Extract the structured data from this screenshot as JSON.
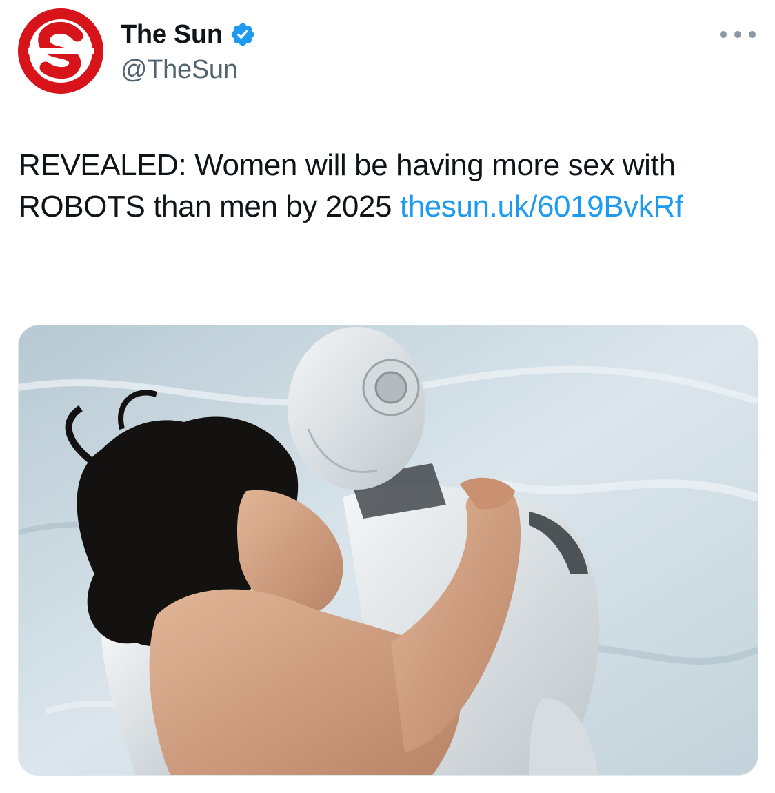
{
  "account": {
    "display_name": "The Sun",
    "handle": "@TheSun",
    "verified": true,
    "avatar_letter": "S",
    "avatar_color": "#d7141a"
  },
  "tweet": {
    "text_main": "REVEALED: Women will be having more sex with ROBOTS than men by 2025 ",
    "link_part1": "thesun.uk/",
    "link_part2": "6019BvkRf"
  },
  "media": {
    "description_kind": "photo"
  },
  "colors": {
    "link": "#1d9bf0",
    "verified": "#1d9bf0",
    "secondary_text": "#536471",
    "brand": "#d7141a"
  },
  "icons": {
    "verified": "verified-badge-icon",
    "more": "more-options-icon"
  }
}
